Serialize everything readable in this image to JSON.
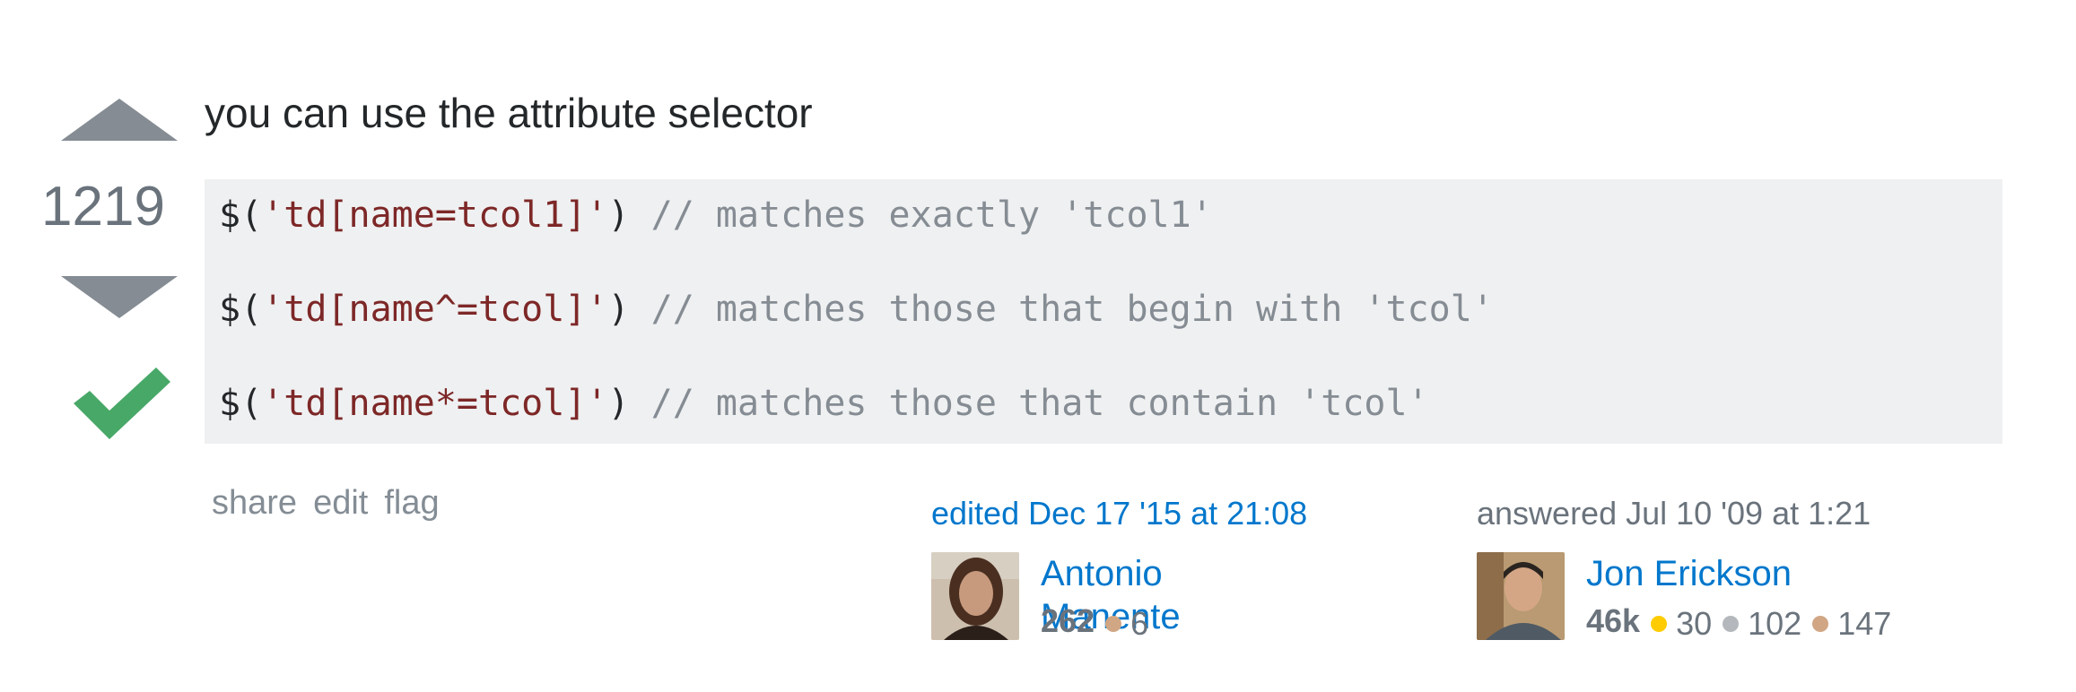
{
  "vote": {
    "count": "1219",
    "up_icon": "arrow-up-icon",
    "down_icon": "arrow-down-icon",
    "accepted_icon": "checkmark-icon",
    "arrow_color": "#858c93",
    "accepted_color": "#48a868"
  },
  "post": {
    "text": "you can use the attribute selector",
    "code": [
      {
        "fn": "$(",
        "str": "'td[name=tcol1]'",
        "close": ") ",
        "comment": "// matches exactly 'tcol1'"
      },
      {
        "fn": "$(",
        "str": "'td[name^=tcol]'",
        "close": ") ",
        "comment": "// matches those that begin with 'tcol'"
      },
      {
        "fn": "$(",
        "str": "'td[name*=tcol]'",
        "close": ") ",
        "comment": "// matches those that contain 'tcol'"
      }
    ]
  },
  "menu": {
    "share": "share",
    "edit": "edit",
    "flag": "flag"
  },
  "editor": {
    "action": "edited Dec 17 '15 at 21:08",
    "name": "Antonio Manente",
    "reputation": "262",
    "bronze": "6"
  },
  "owner": {
    "action": "answered Jul 10 '09 at 1:21",
    "name": "Jon Erickson",
    "reputation": "46k",
    "gold": "30",
    "silver": "102",
    "bronze": "147"
  },
  "colors": {
    "link": "#0077cc",
    "code_bg": "#eff0f1",
    "gold": "#ffcc01",
    "silver": "#b4b8bc",
    "bronze": "#d1a684"
  }
}
